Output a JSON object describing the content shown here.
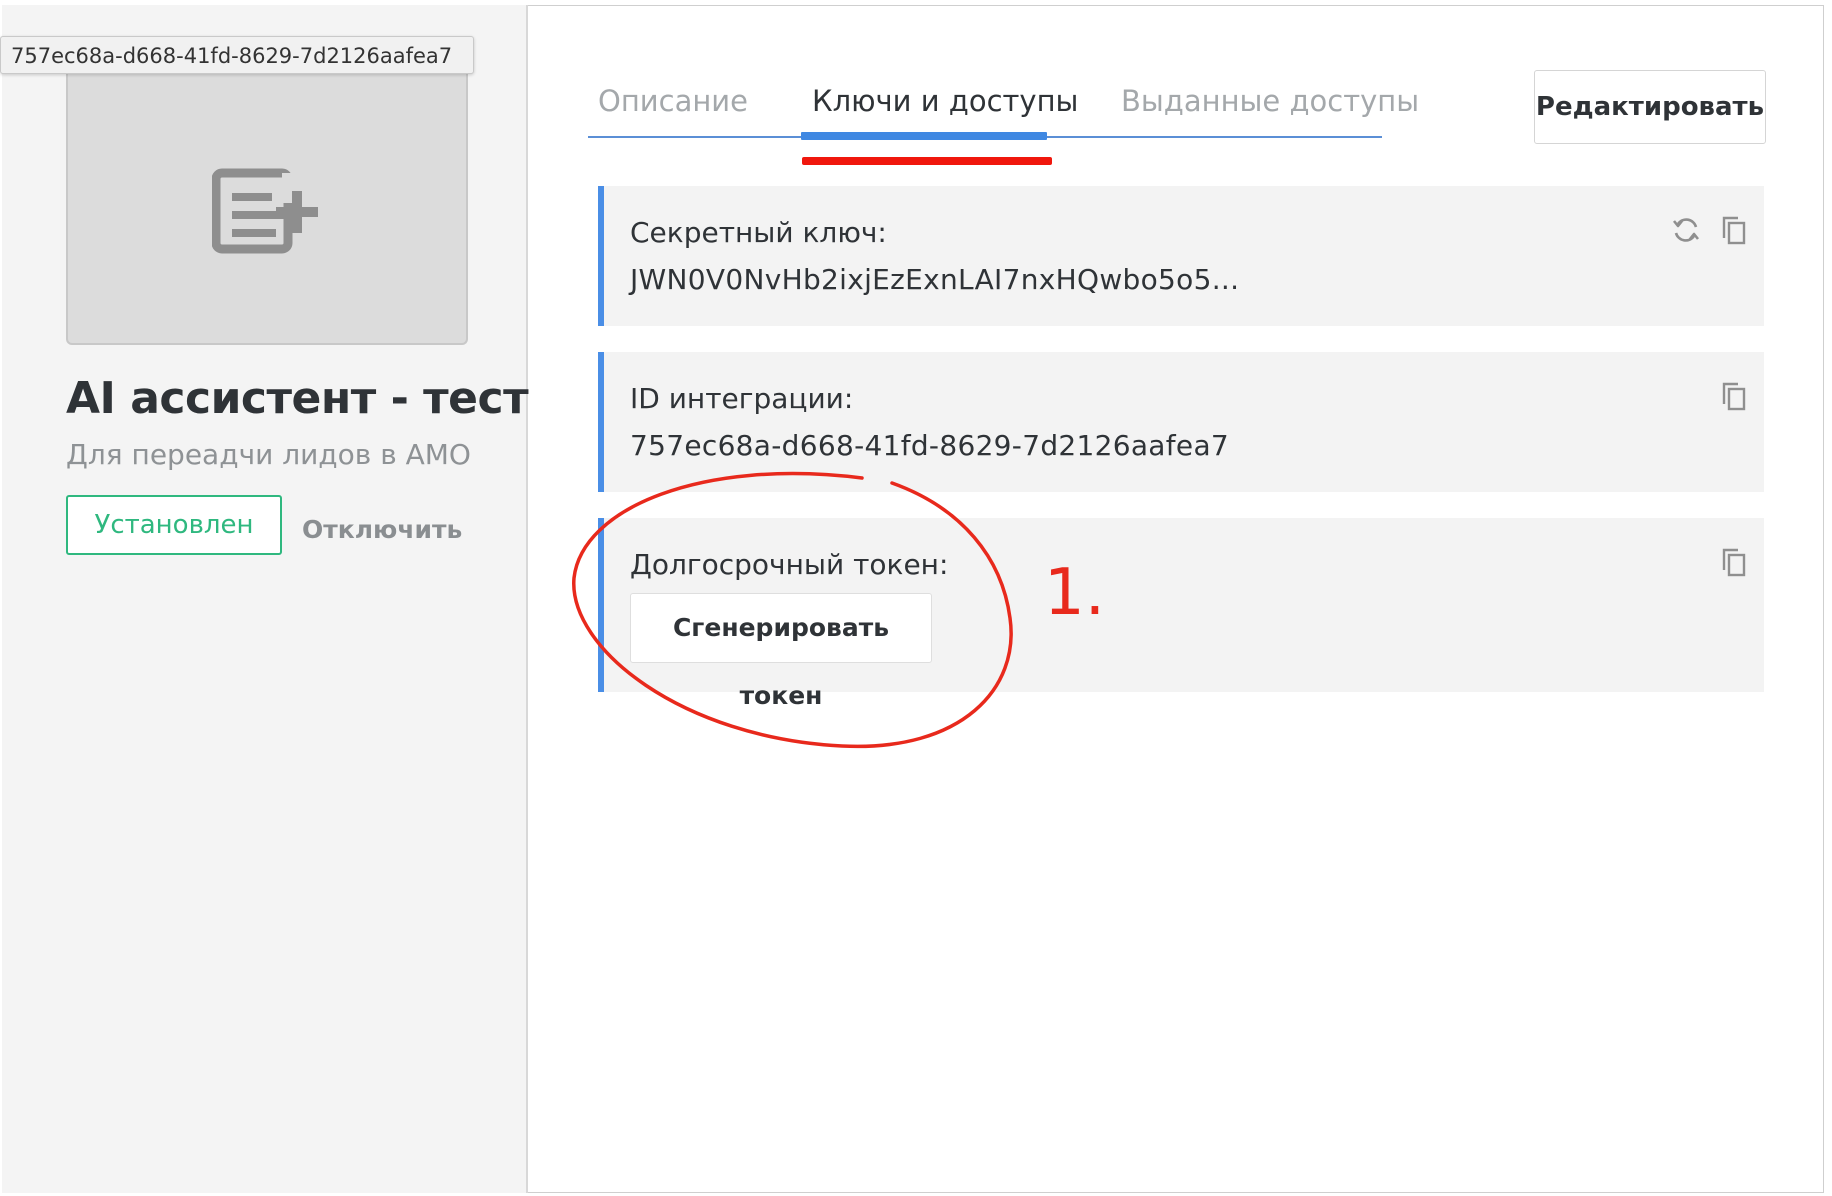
{
  "tooltip": {
    "text": "757ec68a-d668-41fd-8629-7d2126aafea7"
  },
  "sidebar": {
    "logo_icon": "add-list-icon",
    "app_title": "AI ассистент - тест",
    "app_description": "Для переадчи лидов в АМО",
    "installed_label": "Установлен",
    "disable_label": "Отключить"
  },
  "tabs": [
    {
      "label": "Описание",
      "active": false
    },
    {
      "label": "Ключи и доступы",
      "active": true
    },
    {
      "label": "Выданные доступы",
      "active": false
    }
  ],
  "edit_label": "Редактировать",
  "cards": {
    "secret": {
      "label": "Секретный ключ:",
      "value": "JWN0V0NvHb2ixjEzExnLAI7nxHQwbo5o5...",
      "icons": [
        "refresh-icon",
        "copy-icon"
      ]
    },
    "integration_id": {
      "label": "ID интеграции:",
      "value": "757ec68a-d668-41fd-8629-7d2126aafea7",
      "icons": [
        "copy-icon"
      ]
    },
    "long_token": {
      "label": "Долгосрочный токен:",
      "button_label": "Сгенерировать токен",
      "icons": [
        "copy-icon"
      ]
    }
  },
  "annotation": {
    "number": "1.",
    "color": "#e8291c"
  },
  "colors": {
    "accent": "#4a8ee6",
    "success": "#2fb87f",
    "annotation_red": "#f0170d"
  }
}
